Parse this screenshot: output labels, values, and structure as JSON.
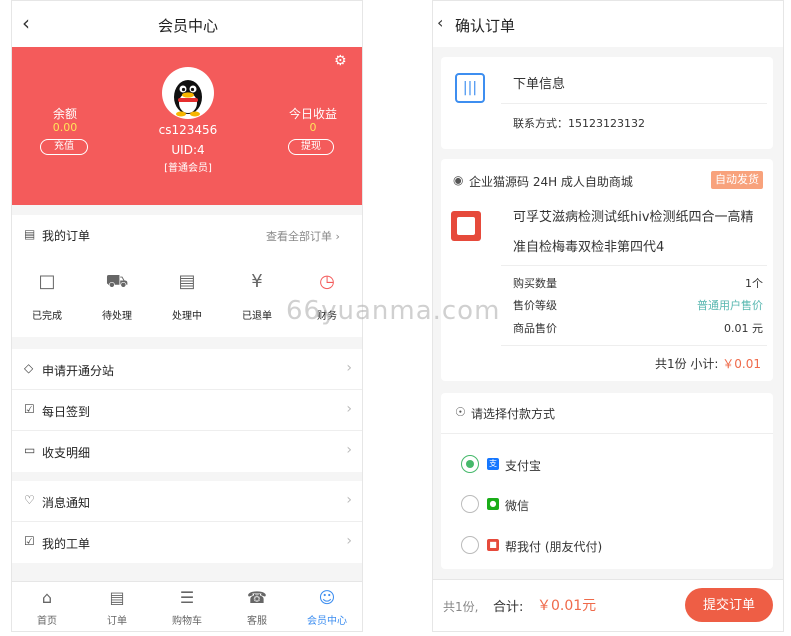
{
  "left": {
    "title": "会员中心",
    "back_icon": "chevron-left",
    "settings_icon": "gear",
    "user": {
      "name": "cs123456",
      "uid": "UID:4",
      "level": "[普通会员]"
    },
    "balance": {
      "label": "余额",
      "value": "0.00",
      "button": "充值"
    },
    "income": {
      "label": "今日收益",
      "value": "0",
      "button": "提现"
    },
    "orders": {
      "title": "我的订单",
      "view_all": "查看全部订单",
      "items": [
        {
          "label": "已完成",
          "icon": "check-box"
        },
        {
          "label": "待处理",
          "icon": "truck"
        },
        {
          "label": "处理中",
          "icon": "box"
        },
        {
          "label": "已退单",
          "icon": "yen-circle"
        },
        {
          "label": "财务",
          "icon": "clock"
        }
      ]
    },
    "menu1": [
      {
        "label": "申请开通分站",
        "icon": "diamond"
      },
      {
        "label": "每日签到",
        "icon": "checkbox"
      },
      {
        "label": "收支明细",
        "icon": "card"
      }
    ],
    "menu2": [
      {
        "label": "消息通知",
        "icon": "bell"
      },
      {
        "label": "我的工单",
        "icon": "checkbox-outline"
      }
    ],
    "tabbar": [
      {
        "label": "首页",
        "icon": "home"
      },
      {
        "label": "订单",
        "icon": "list"
      },
      {
        "label": "购物车",
        "icon": "cart"
      },
      {
        "label": "客服",
        "icon": "headset"
      },
      {
        "label": "会员中心",
        "icon": "user",
        "active": true
      }
    ]
  },
  "right": {
    "title": "确认订单",
    "order_info": {
      "title": "下单信息",
      "contact": "联系方式：15123123132"
    },
    "product": {
      "store": "企业猫源码 24H 成人自助商城",
      "badge": "自动发货",
      "name": "可孚艾滋病检测试纸hiv检测纸四合一高精准自检梅毒双检非第四代4",
      "fields": [
        {
          "k": "购买数量",
          "v": "1个"
        },
        {
          "k": "售价等级",
          "v": "普通用户售价"
        },
        {
          "k": "商品售价",
          "v": "0.01 元"
        }
      ],
      "subtotal_label": "共1份 小计:",
      "subtotal_value": "￥0.01"
    },
    "payment": {
      "title": "请选择付款方式",
      "options": [
        {
          "label": "支付宝",
          "selected": true,
          "color": "#1677ff"
        },
        {
          "label": "微信",
          "selected": false,
          "color": "#1aad19"
        },
        {
          "label": "帮我付 (朋友代付)",
          "selected": false,
          "color": "#e64a3b"
        }
      ]
    },
    "footer": {
      "qty": "共1份,",
      "total_label": "合计:",
      "total_value": "￥0.01元",
      "submit": "提交订单"
    }
  },
  "watermark": "66yuanma.com",
  "colors": {
    "hero": "#f45b5b",
    "accent": "#3d8ef0",
    "price": "#ef6a4a",
    "submit": "#ee5e45",
    "radio": "#46b96b"
  }
}
